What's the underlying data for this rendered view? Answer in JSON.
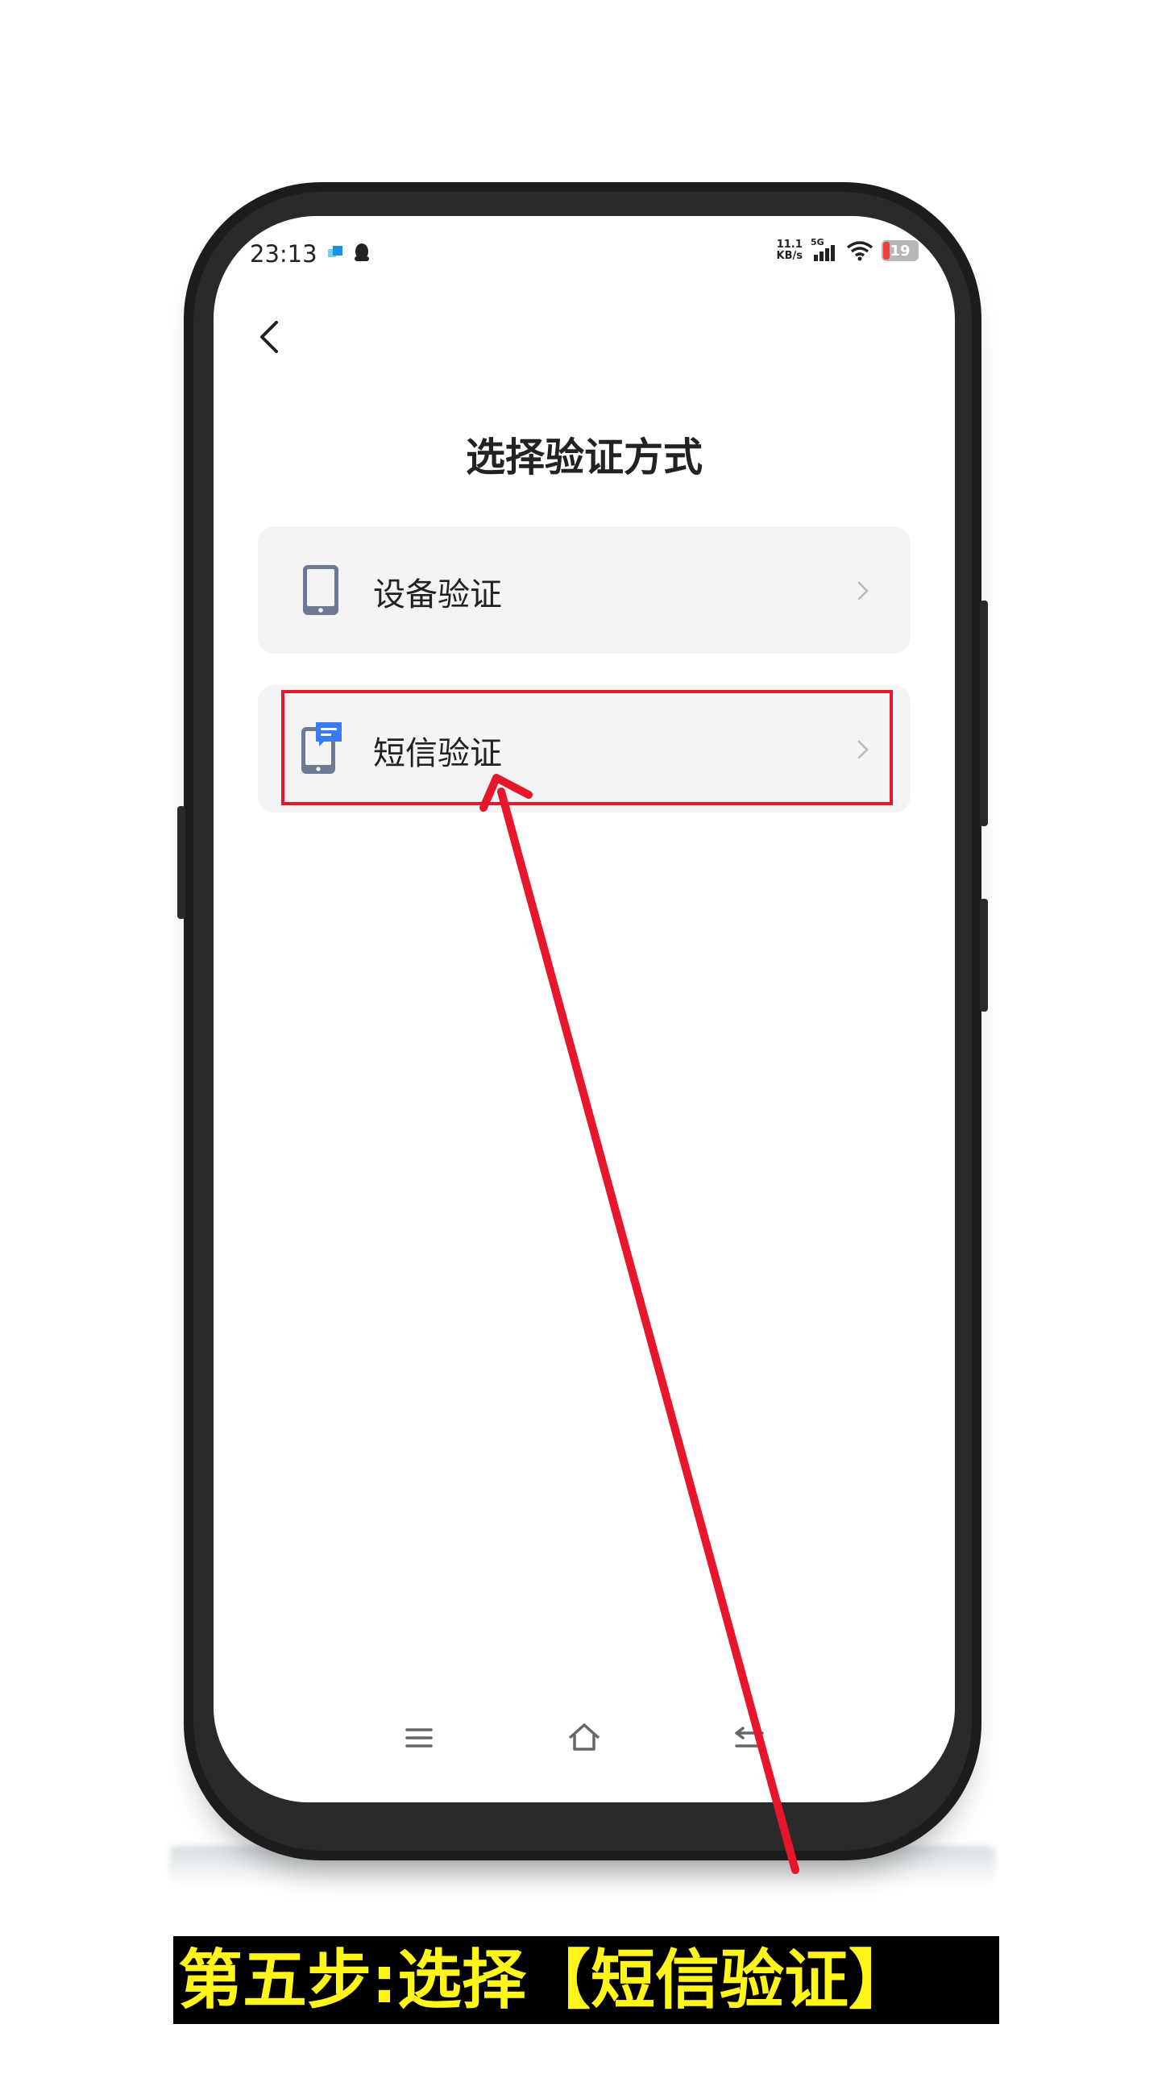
{
  "status_bar": {
    "time": "23:13",
    "net_speed_value": "11.1",
    "net_speed_unit": "KB/s",
    "network": "5G",
    "battery": "19"
  },
  "header": {
    "title": "选择验证方式"
  },
  "options": [
    {
      "label": "设备验证",
      "icon": "tablet-icon"
    },
    {
      "label": "短信验证",
      "icon": "sms-phone-icon"
    }
  ],
  "caption": "第五步:选择【短信验证】",
  "colors": {
    "highlight": "#e8162b",
    "caption_text": "#fff51a",
    "sms_accent": "#3b7cf6"
  }
}
